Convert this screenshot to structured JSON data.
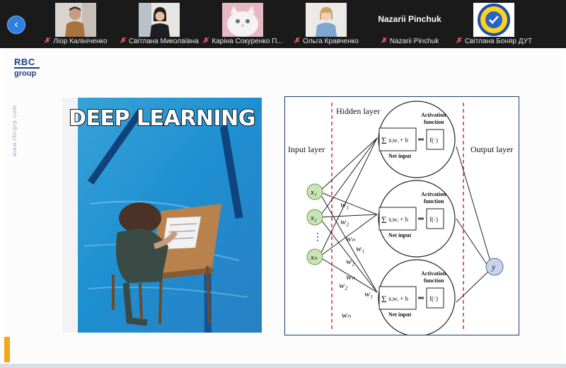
{
  "participants": [
    {
      "name": "Лiор Калiнiченко"
    },
    {
      "name": "Свiтлана Миколаївна"
    },
    {
      "name": "Карiна Сокуренко П..."
    },
    {
      "name": "Ольга Кравченко"
    },
    {
      "name": "Nazarii Pinchuk",
      "tile_label": "Nazarii Pinchuk"
    },
    {
      "name": "Свiтлана Боняр ДУТ"
    }
  ],
  "slide": {
    "logo_line1": "RBC",
    "logo_line2": "group",
    "side_url": "www.rbcgrp.com",
    "meme_title": "DEEP LEARNING",
    "diagram": {
      "hidden_layer": "Hidden layer",
      "input_layer": "Input layer",
      "output_layer": "Output layer",
      "activation": [
        "Activation",
        "function"
      ],
      "net_input": "Net input",
      "sum_formula": "xᵢwᵢ + b",
      "activation_fn": "f(·)",
      "output_node": "y",
      "input_nodes": [
        "x₁",
        "x₂",
        "xₙ"
      ],
      "dots": "⋮",
      "weights": [
        "w₁",
        "w₂",
        "wₙ",
        "w₁",
        "w₂",
        "wₙ",
        "w₂",
        "w₁",
        "wₙ"
      ]
    }
  },
  "colors": {
    "accent": "#2f7fe0",
    "diagram_border": "#1f3a6e",
    "input_node": "#c9e3b4",
    "output_node": "#c7d3ec",
    "dash_red": "#d92b2b"
  }
}
